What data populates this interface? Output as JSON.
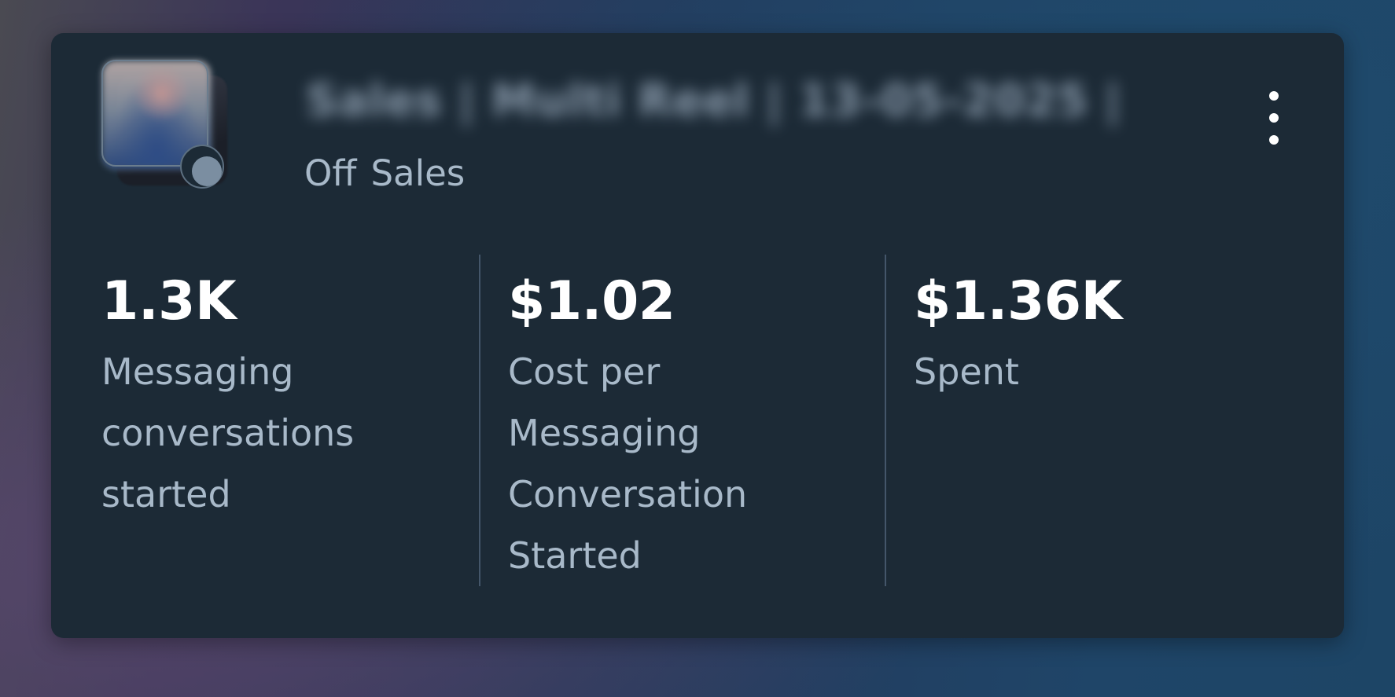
{
  "header": {
    "campaign_title": "Sales | Multi Reel | 13-05-2025 |",
    "status": "Off",
    "objective": "Sales",
    "more_icon": "more-vertical-icon"
  },
  "metrics": [
    {
      "value": "1.3K",
      "label_lines": [
        "Messaging",
        "conversations",
        "started"
      ]
    },
    {
      "value": "$1.02",
      "label_lines": [
        "Cost per",
        "Messaging",
        "Conversation",
        "Started"
      ]
    },
    {
      "value": "$1.36K",
      "label_lines": [
        "Spent"
      ]
    }
  ],
  "colors": {
    "card_background": "#1c2a36",
    "value_text": "#ffffff",
    "label_text": "#a8b9c9",
    "status_dot": "#7b8ea1"
  }
}
